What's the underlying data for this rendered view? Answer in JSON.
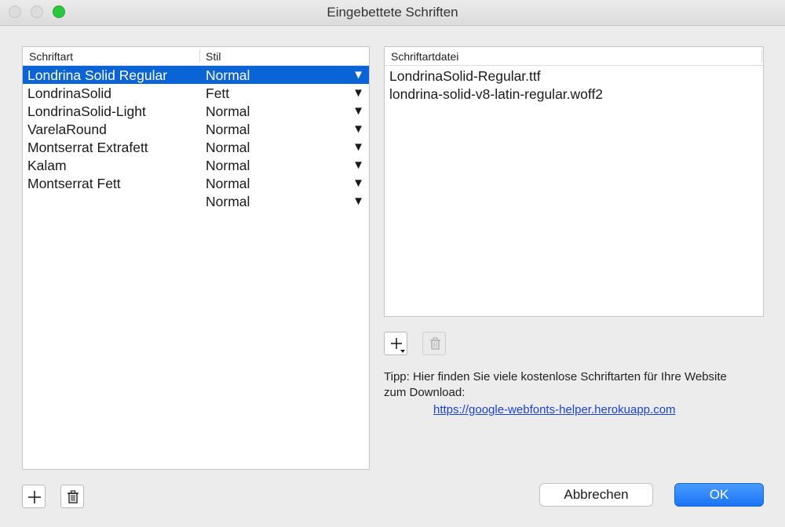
{
  "window": {
    "title": "Eingebettete Schriften"
  },
  "fonts_table": {
    "headers": {
      "name": "Schriftart",
      "style": "Stil"
    },
    "rows": [
      {
        "name": "Londrina Solid Regular",
        "style": "Normal"
      },
      {
        "name": "LondrinaSolid",
        "style": "Fett"
      },
      {
        "name": "LondrinaSolid-Light",
        "style": "Normal"
      },
      {
        "name": "VarelaRound",
        "style": "Normal"
      },
      {
        "name": "Montserrat Extrafett",
        "style": "Normal"
      },
      {
        "name": "Kalam",
        "style": "Normal"
      },
      {
        "name": "Montserrat Fett",
        "style": "Normal"
      },
      {
        "name": "",
        "style": "Normal"
      }
    ],
    "dropdown_arrow": "▼"
  },
  "files_table": {
    "header": "Schriftartdatei",
    "rows": [
      "LondrinaSolid-Regular.ttf",
      "londrina-solid-v8-latin-regular.woff2"
    ]
  },
  "tip": {
    "text": "Tipp: Hier finden Sie viele kostenlose Schriftarten für Ihre Website zum Download:",
    "link": "https://google-webfonts-helper.herokuapp.com"
  },
  "buttons": {
    "cancel": "Abbrechen",
    "ok": "OK"
  },
  "colors": {
    "selection": "#0b64d6",
    "ok": "#1a73f5",
    "link": "#1a3fe3",
    "maximize": "#2cc73f"
  }
}
